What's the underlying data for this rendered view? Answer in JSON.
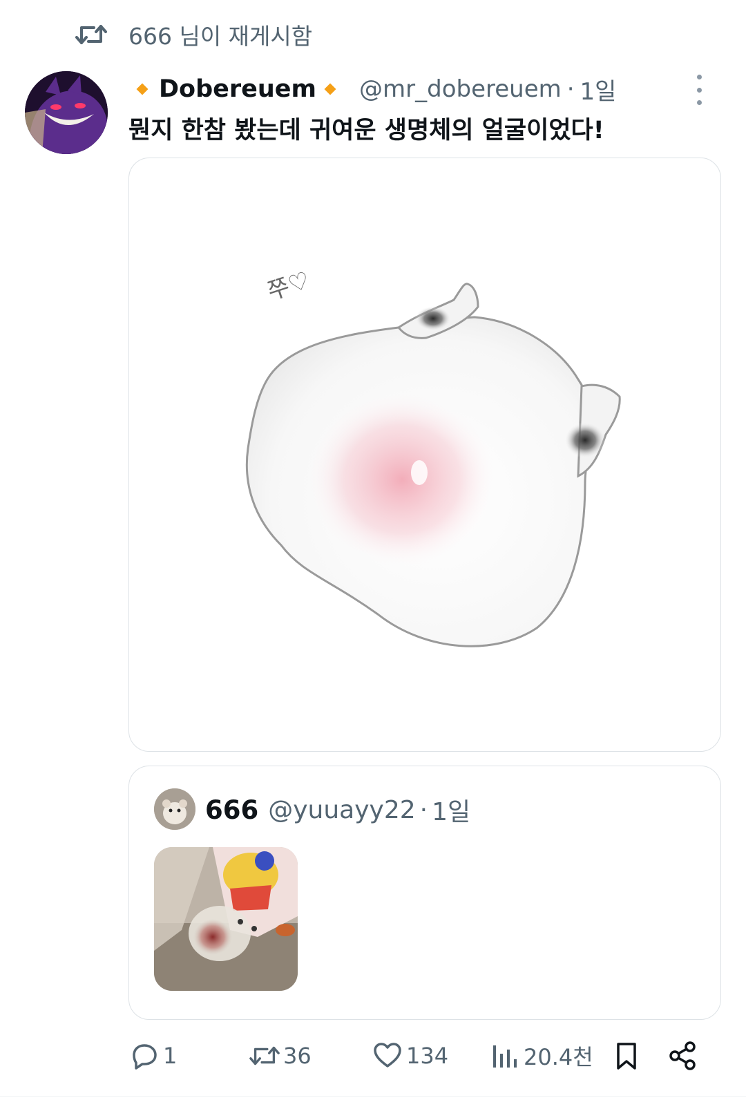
{
  "repost_banner": {
    "text": "666 님이 재게시함",
    "icon": "repost-icon"
  },
  "tweet": {
    "author_name": "Dobereuem",
    "author_handle": "@mr_dobereuem",
    "separator": "·",
    "time": "1일",
    "text": "뭔지 한참 봤는데 귀여운 생명체의 얼굴이었다!",
    "image_caption_handwritten": "쭈♡",
    "badge_color": "#f5a017"
  },
  "quoted_tweet": {
    "author_name": "666",
    "author_handle": "@yuuayy22",
    "separator": "·",
    "time": "1일"
  },
  "actions": {
    "replies": "1",
    "reposts": "36",
    "likes": "134",
    "views": "20.4천"
  },
  "icons": [
    "repost-icon",
    "more-icon",
    "reply-icon",
    "like-icon",
    "views-icon",
    "bookmark-icon",
    "share-icon"
  ],
  "colors": {
    "text": "#0f1419",
    "secondary": "#536471",
    "border": "#dde2e6"
  }
}
